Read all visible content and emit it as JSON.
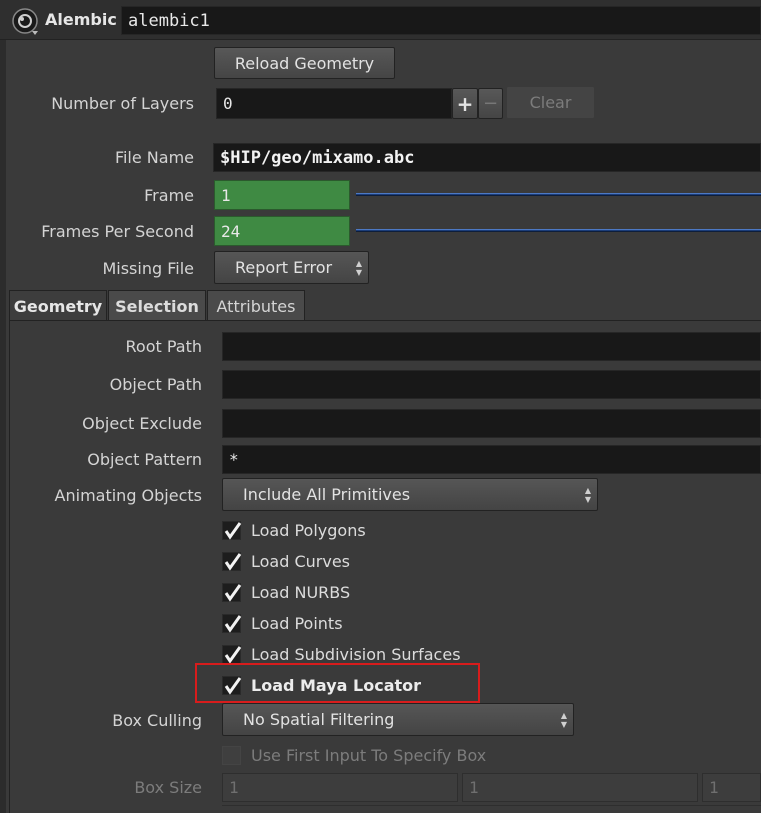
{
  "header": {
    "node_type": "Alembic",
    "node_name": "alembic1"
  },
  "top": {
    "reload_label": "Reload Geometry",
    "layers_label": "Number of Layers",
    "layers_value": "0",
    "plus_label": "+",
    "minus_label": "−",
    "clear_label": "Clear",
    "file_name_label": "File Name",
    "file_name_value": "$HIP/geo/mixamo.abc",
    "frame_label": "Frame",
    "frame_value": "1",
    "fps_label": "Frames Per Second",
    "fps_value": "24",
    "missing_label": "Missing File",
    "missing_value": "Report Error"
  },
  "tabs": [
    {
      "label": "Geometry"
    },
    {
      "label": "Selection"
    },
    {
      "label": "Attributes"
    }
  ],
  "geometry": {
    "root_path_label": "Root Path",
    "root_path_value": "",
    "object_path_label": "Object Path",
    "object_path_value": "",
    "object_exclude_label": "Object Exclude",
    "object_exclude_value": "",
    "object_pattern_label": "Object Pattern",
    "object_pattern_value": "*",
    "animating_label": "Animating Objects",
    "animating_value": "Include All Primitives",
    "checks": [
      {
        "label": "Load Polygons",
        "checked": true
      },
      {
        "label": "Load Curves",
        "checked": true
      },
      {
        "label": "Load NURBS",
        "checked": true
      },
      {
        "label": "Load Points",
        "checked": true
      },
      {
        "label": "Load Subdivision Surfaces",
        "checked": true
      },
      {
        "label": "Load Maya Locator",
        "checked": true
      }
    ],
    "box_culling_label": "Box Culling",
    "box_culling_value": "No Spatial Filtering",
    "use_first_input_label": "Use First Input To Specify Box",
    "box_size_label": "Box Size",
    "box_size_values": [
      "1",
      "1",
      "1"
    ]
  },
  "colors": {
    "highlight": "#d81c1c",
    "field_green": "#3f8a43",
    "slider_blue": "#1b3d7a"
  }
}
